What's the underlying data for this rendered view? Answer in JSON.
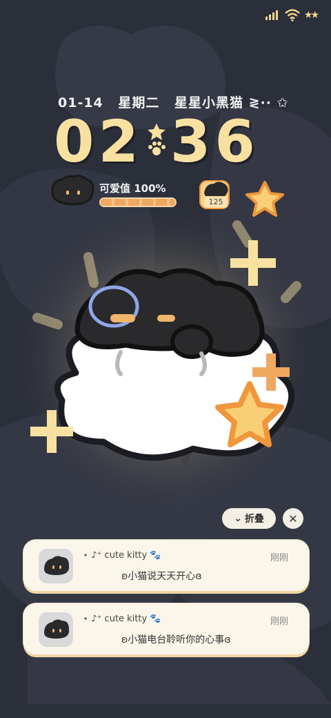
{
  "status_bar": {
    "signal_icon": "signal-bars-icon",
    "wifi_icon": "wifi-icon",
    "battery_icon": "stars-battery-icon",
    "battery_glyph": "★★"
  },
  "lockscreen": {
    "date": "01-14",
    "weekday": "星期二",
    "tagline": "星星小黑猫 ≷·· ✩",
    "hour": "02",
    "minute": "36",
    "love_label": "可爱值 100%",
    "love_value": 1.0,
    "badge_count": "125"
  },
  "notifications": {
    "fold_label": "折叠",
    "close_glyph": "✕",
    "items": [
      {
        "app": "⋆ ♪⁺ cute kitty 🐾",
        "time": "刚刚",
        "message": "ʚ小猫说天天开心ɞ"
      },
      {
        "app": "⋆ ♪⁺ cute kitty 🐾",
        "time": "刚刚",
        "message": "ʚ小猫电台聆听你的心事ɞ"
      }
    ]
  },
  "colors": {
    "background": "#2b2f3a",
    "clock": "#f8e1a0",
    "accent_orange": "#f0a860",
    "card": "#fbf6ea"
  }
}
